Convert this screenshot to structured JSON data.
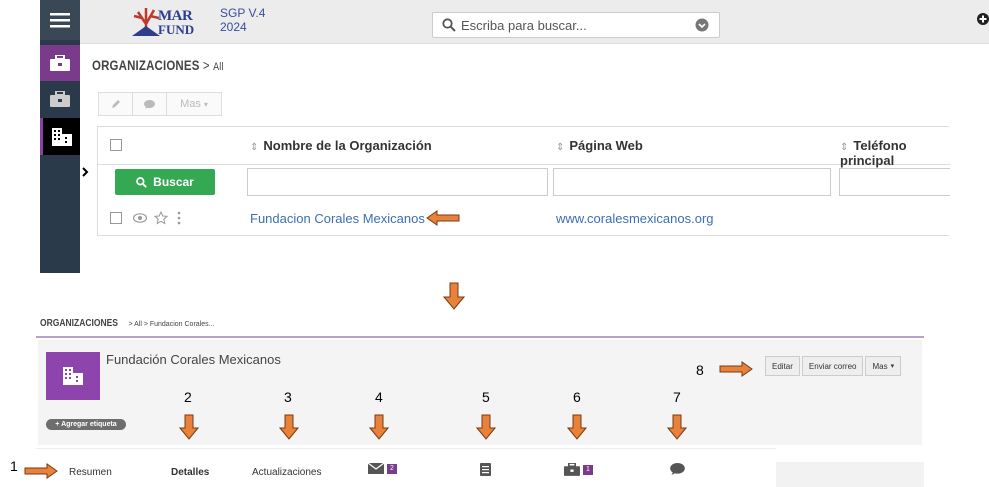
{
  "top": {
    "logo": {
      "line1": "MAR",
      "line2": "FUND"
    },
    "version": {
      "line1": "SGP V.4",
      "line2": "2024"
    },
    "search": {
      "placeholder": "Escriba para buscar..."
    },
    "breadcrumb": {
      "module": "ORGANIZACIONES",
      "separator": ">",
      "view": "All"
    },
    "action_bar": {
      "more_label": "Mas"
    },
    "table": {
      "columns": [
        "Nombre de la Organización",
        "Página Web",
        "Teléfono principal"
      ],
      "search_button": "Buscar",
      "rows": [
        {
          "name": "Fundacion Corales Mexicanos",
          "website": "www.coralesmexicanos.org",
          "phone": ""
        }
      ]
    },
    "sidebar_icons": [
      "menu-icon",
      "briefcase-icon",
      "briefcase-icon",
      "building-icon"
    ]
  },
  "bottom": {
    "breadcrumb": {
      "module": "ORGANIZACIONES",
      "trail": "> All > Fundacion Corales..."
    },
    "record_title": "Fundación Corales Mexicanos",
    "tag_button": "+ Agregar etiqueta",
    "actions": [
      "Editar",
      "Enviar correo",
      "Mas"
    ],
    "tabs": [
      {
        "label": "Resumen"
      },
      {
        "label": "Detalles"
      },
      {
        "label": "Actualizaciones"
      },
      {
        "icon": "envelope-icon",
        "badge": "2"
      },
      {
        "icon": "document-icon"
      },
      {
        "icon": "briefcase-icon",
        "badge": "1"
      },
      {
        "icon": "comment-icon"
      }
    ]
  },
  "annotations": {
    "numbers": [
      "1",
      "2",
      "3",
      "4",
      "5",
      "6",
      "7",
      "8"
    ],
    "arrow_color": "#e8823a"
  },
  "colors": {
    "sidebar": "#2b3a4a",
    "accent_purple": "#8e44ad",
    "search_green": "#34a853",
    "link_blue": "#3a6fb5"
  }
}
